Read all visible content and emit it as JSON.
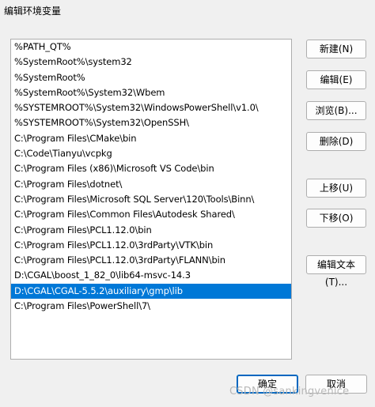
{
  "window": {
    "title": "编辑环境变量"
  },
  "paths": [
    "%PATH_QT%",
    "%SystemRoot%\\system32",
    "%SystemRoot%",
    "%SystemRoot%\\System32\\Wbem",
    "%SYSTEMROOT%\\System32\\WindowsPowerShell\\v1.0\\",
    "%SYSTEMROOT%\\System32\\OpenSSH\\",
    "C:\\Program Files\\CMake\\bin",
    "C:\\Code\\Tianyu\\vcpkg",
    "C:\\Program Files (x86)\\Microsoft VS Code\\bin",
    "C:\\Program Files\\dotnet\\",
    "C:\\Program Files\\Microsoft SQL Server\\120\\Tools\\Binn\\",
    "C:\\Program Files\\Common Files\\Autodesk Shared\\",
    "C:\\Program Files\\PCL1.12.0\\bin",
    "C:\\Program Files\\PCL1.12.0\\3rdParty\\VTK\\bin",
    "C:\\Program Files\\PCL1.12.0\\3rdParty\\FLANN\\bin",
    "D:\\CGAL\\boost_1_82_0\\lib64-msvc-14.3",
    "D:\\CGAL\\CGAL-5.5.2\\auxiliary\\gmp\\lib",
    "C:\\Program Files\\PowerShell\\7\\"
  ],
  "selected_index": 16,
  "buttons": {
    "new": "新建(N)",
    "edit": "编辑(E)",
    "browse": "浏览(B)...",
    "delete": "删除(D)",
    "move_up": "上移(U)",
    "move_down": "下移(O)",
    "edit_text": "编辑文本(T)...",
    "ok": "确定",
    "cancel": "取消"
  },
  "watermark": "CSDN @sankingvenice",
  "colors": {
    "selection": "#0078d7",
    "primary_border": "#0067c0"
  }
}
